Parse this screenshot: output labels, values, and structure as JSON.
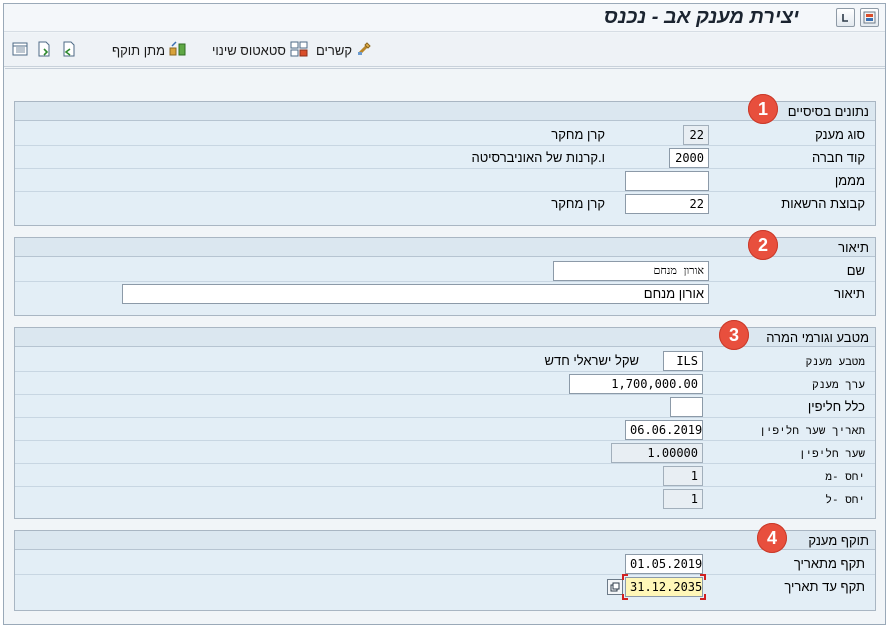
{
  "window": {
    "title": "יצירת מענק אב - נכנס"
  },
  "toolbar": {
    "items": [
      {
        "label": "קשרים",
        "icon": "links-icon"
      },
      {
        "label": "סטאטוס שינוי",
        "icon": "status-change-icon"
      },
      {
        "label": "מתן תוקף",
        "icon": "validate-icon"
      }
    ]
  },
  "sections": {
    "basic": {
      "title": "נתונים בסיסיים",
      "badge": "1",
      "grant_type_label": "סוג מענק",
      "grant_type_value": "22",
      "grant_type_desc": "קרן מחקר",
      "company_code_label": "קוד חברה",
      "company_code_value": "2000",
      "company_code_desc": "ו.קרנות של האוניברסיטה",
      "sponsor_label": "מממן",
      "sponsor_value": "",
      "auth_group_label": "קבוצת הרשאות",
      "auth_group_value": "22",
      "auth_group_desc": "קרן מחקר"
    },
    "description": {
      "title": "תיאור",
      "badge": "2",
      "name_label": "שם",
      "name_value": "אורון מנחם",
      "desc_label": "תיאור",
      "desc_value": "אורון מנחם"
    },
    "currency": {
      "title": "מטבע וגורמי המרה",
      "badge": "3",
      "currency_label": "מטבע מענק",
      "currency_value": "ILS",
      "currency_desc": "שקל ישראלי חדש",
      "amount_label": "ערך מענק",
      "amount_value": "1,700,000.00",
      "rule_label": "כלל חליפין",
      "rule_value": "",
      "rate_date_label": "תאריך שער חליפין",
      "rate_date_value": "06.06.2019",
      "rate_label": "שער חליפין",
      "rate_value": "1.00000",
      "ratio_from_label": "יחס -מ",
      "ratio_from_value": "1",
      "ratio_to_label": "יחס -ל",
      "ratio_to_value": "1"
    },
    "validity": {
      "title": "תוקף מענק",
      "badge": "4",
      "from_label": "תקף מתאריך",
      "from_value": "01.05.2019",
      "to_label": "תקף עד תאריך",
      "to_value": "31.12.2035"
    }
  },
  "colors": {
    "badge": "#e84f3d",
    "group_background": "#e3eef6",
    "highlight_field": "#fff7b8"
  }
}
